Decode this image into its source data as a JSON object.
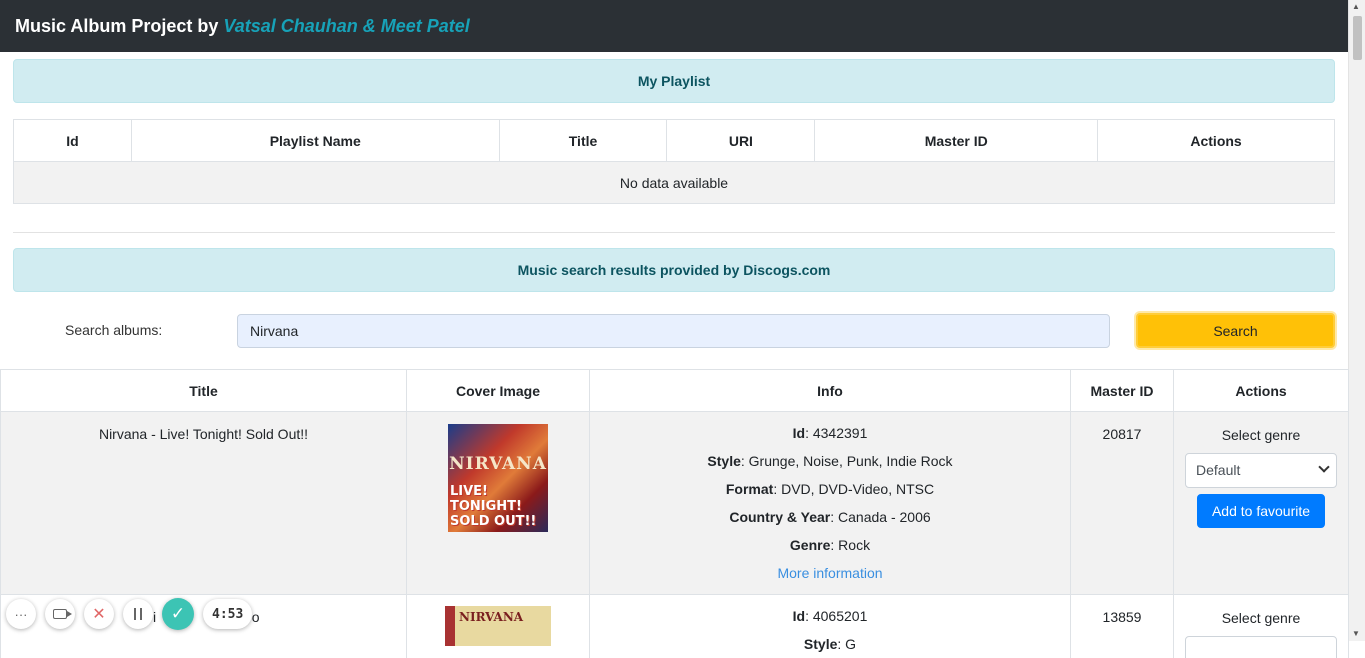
{
  "header": {
    "title_prefix": "Music Album Project by",
    "authors": "Vatsal Chauhan & Meet Patel"
  },
  "playlist": {
    "heading": "My Playlist",
    "columns": [
      "Id",
      "Playlist Name",
      "Title",
      "URI",
      "Master ID",
      "Actions"
    ],
    "empty_text": "No data available"
  },
  "search": {
    "heading": "Music search results provided by Discogs.com",
    "label": "Search albums:",
    "value": "Nirvana",
    "button_label": "Search"
  },
  "results": {
    "columns": [
      "Title",
      "Cover Image",
      "Info",
      "Master ID",
      "Actions"
    ],
    "field_labels": {
      "id": "Id",
      "style": "Style",
      "format": "Format",
      "country_year": "Country & Year",
      "genre": "Genre"
    },
    "more_link": "More information",
    "select_genre_label": "Select genre",
    "genre_default": "Default",
    "fav_button": "Add to favourite",
    "rows": [
      {
        "title": "Nirvana - Live! Tonight! Sold Out!!",
        "cover_band": "NIRVANA",
        "cover_sub": "LIVE! TONIGHT! SOLD OUT!!",
        "id": ": 4342391",
        "style": ": Grunge, Noise, Punk, Indie Rock",
        "format": ": DVD, DVD-Video, NTSC",
        "country_year": ": Canada - 2006",
        "genre": ": Rock",
        "master_id": "20817"
      },
      {
        "title_partial": "i",
        "title_partial_end": "ro",
        "cover_band": "NIRVANA",
        "id": ": 4065201",
        "style": ": G",
        "master_id": "13859"
      }
    ]
  },
  "recorder": {
    "time": "4:53"
  },
  "icons": {
    "more": "more-dots-icon",
    "camera": "camera-toggle-icon",
    "close": "close-icon",
    "pause": "pause-icon",
    "check": "check-icon"
  },
  "colors": {
    "navbar_bg": "#2b3035",
    "authors": "#17a2b8",
    "alert_bg": "#d1ecf1",
    "alert_text": "#0c5460",
    "search_button": "#ffc107",
    "fav_button": "#007bff",
    "link": "#3a8fe0",
    "recorder_check": "#3cc4b4"
  }
}
